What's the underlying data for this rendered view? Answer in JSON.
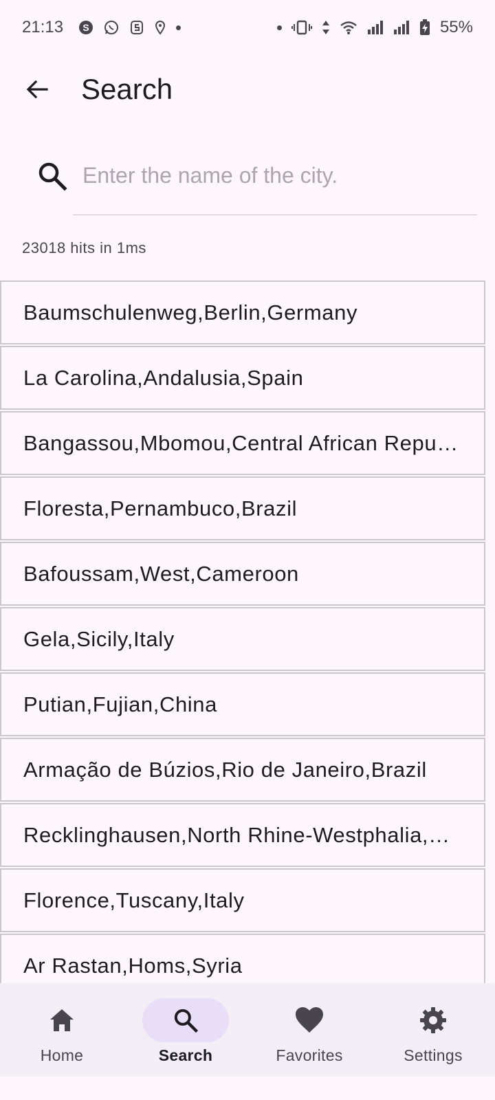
{
  "status_bar": {
    "time": "21:13",
    "battery": "55%",
    "left_icons": [
      "skype-icon",
      "whatsapp-icon",
      "s-app-icon",
      "location-icon",
      "dot-icon"
    ],
    "right_icons": [
      "dot-icon",
      "vibrate-icon",
      "data-arrows-icon",
      "wifi-icon",
      "signal-icon",
      "signal-r-icon",
      "battery-charging-icon"
    ]
  },
  "appbar": {
    "title": "Search",
    "back_icon": "arrow-back-icon"
  },
  "search": {
    "placeholder": "Enter the name of the city.",
    "value": "",
    "icon": "search-icon"
  },
  "hits_text": "23018 hits in 1ms",
  "results": [
    "Baumschulenweg,Berlin,Germany",
    "La Carolina,Andalusia,Spain",
    "Bangassou,Mbomou,Central African Republic",
    "Floresta,Pernambuco,Brazil",
    "Bafoussam,West,Cameroon",
    "Gela,Sicily,Italy",
    "Putian,Fujian,China",
    "Armação de Búzios,Rio de Janeiro,Brazil",
    "Recklinghausen,North Rhine-Westphalia,Germany",
    "Florence,Tuscany,Italy",
    "Ar Rastan,Homs,Syria"
  ],
  "nav": {
    "items": [
      {
        "label": "Home",
        "icon": "home-icon",
        "active": false
      },
      {
        "label": "Search",
        "icon": "search-icon",
        "active": true
      },
      {
        "label": "Favorites",
        "icon": "heart-icon",
        "active": false
      },
      {
        "label": "Settings",
        "icon": "gear-icon",
        "active": false
      }
    ]
  },
  "colors": {
    "background": "#fdf7fd",
    "nav_background": "#f3edf6",
    "active_pill": "#e8def8",
    "text": "#1d1b20"
  }
}
